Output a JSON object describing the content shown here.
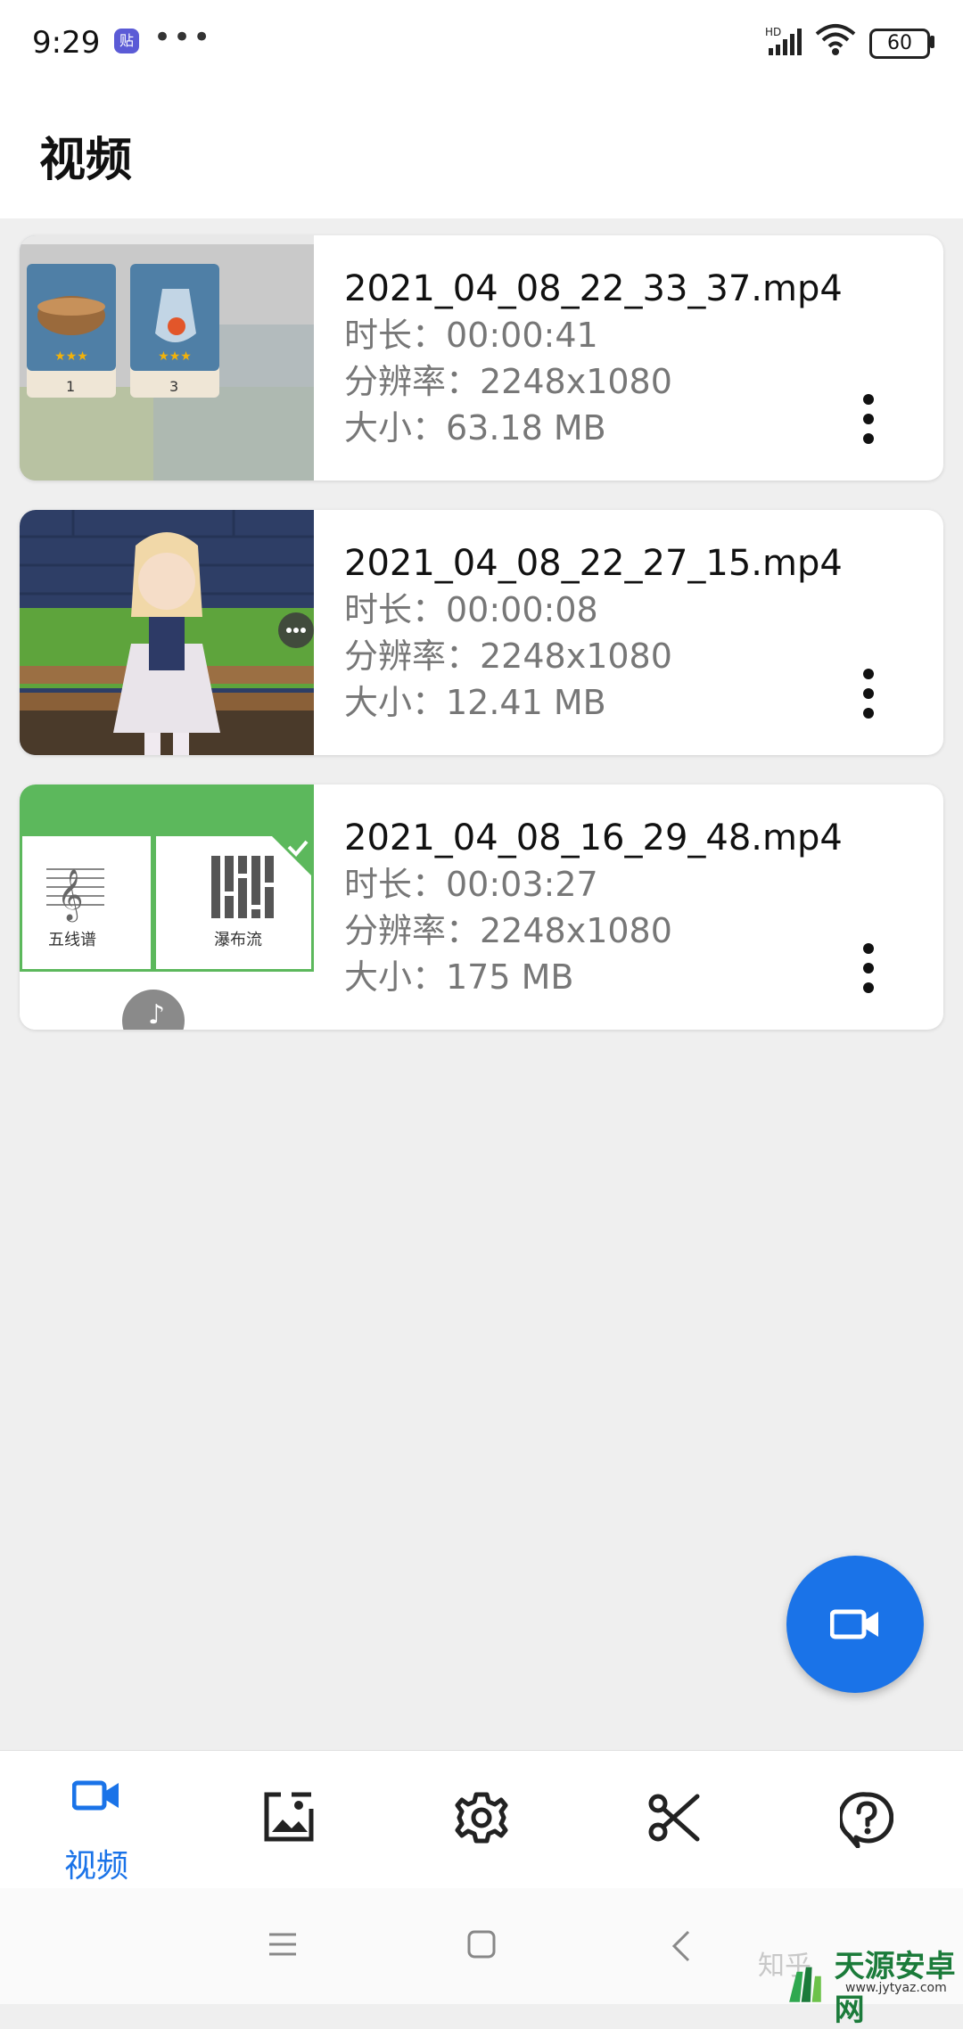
{
  "status_bar": {
    "time": "9:29",
    "app_badge": "贴",
    "more": "•••",
    "network": "HD",
    "battery": "60"
  },
  "header": {
    "title": "视频"
  },
  "videos": [
    {
      "name": "2021_04_08_22_33_37.mp4",
      "duration": "时长：00:00:41",
      "resolution": "分辨率：2248x1080",
      "size": "大小：63.18 MB",
      "thumb_items": [
        "1",
        "3"
      ]
    },
    {
      "name": "2021_04_08_22_27_15.mp4",
      "duration": "时长：00:00:08",
      "resolution": "分辨率：2248x1080",
      "size": "大小：12.41 MB"
    },
    {
      "name": "2021_04_08_16_29_48.mp4",
      "duration": "时长：00:03:27",
      "resolution": "分辨率：2248x1080",
      "size": "大小：175 MB",
      "thumb_labels": [
        "五线谱",
        "瀑布流"
      ]
    }
  ],
  "bottom_nav": {
    "items": [
      {
        "icon": "video-camera-icon",
        "label": "视频",
        "active": true
      },
      {
        "icon": "image-icon",
        "active": false
      },
      {
        "icon": "settings-gear-icon",
        "active": false
      },
      {
        "icon": "scissors-icon",
        "active": false
      },
      {
        "icon": "help-icon",
        "active": false
      }
    ]
  },
  "watermark": {
    "text": "知乎",
    "brand": "天源安卓网",
    "url": "www.jytyaz.com"
  },
  "colors": {
    "accent": "#1a73e8",
    "background": "#efefef",
    "card": "#ffffff"
  }
}
